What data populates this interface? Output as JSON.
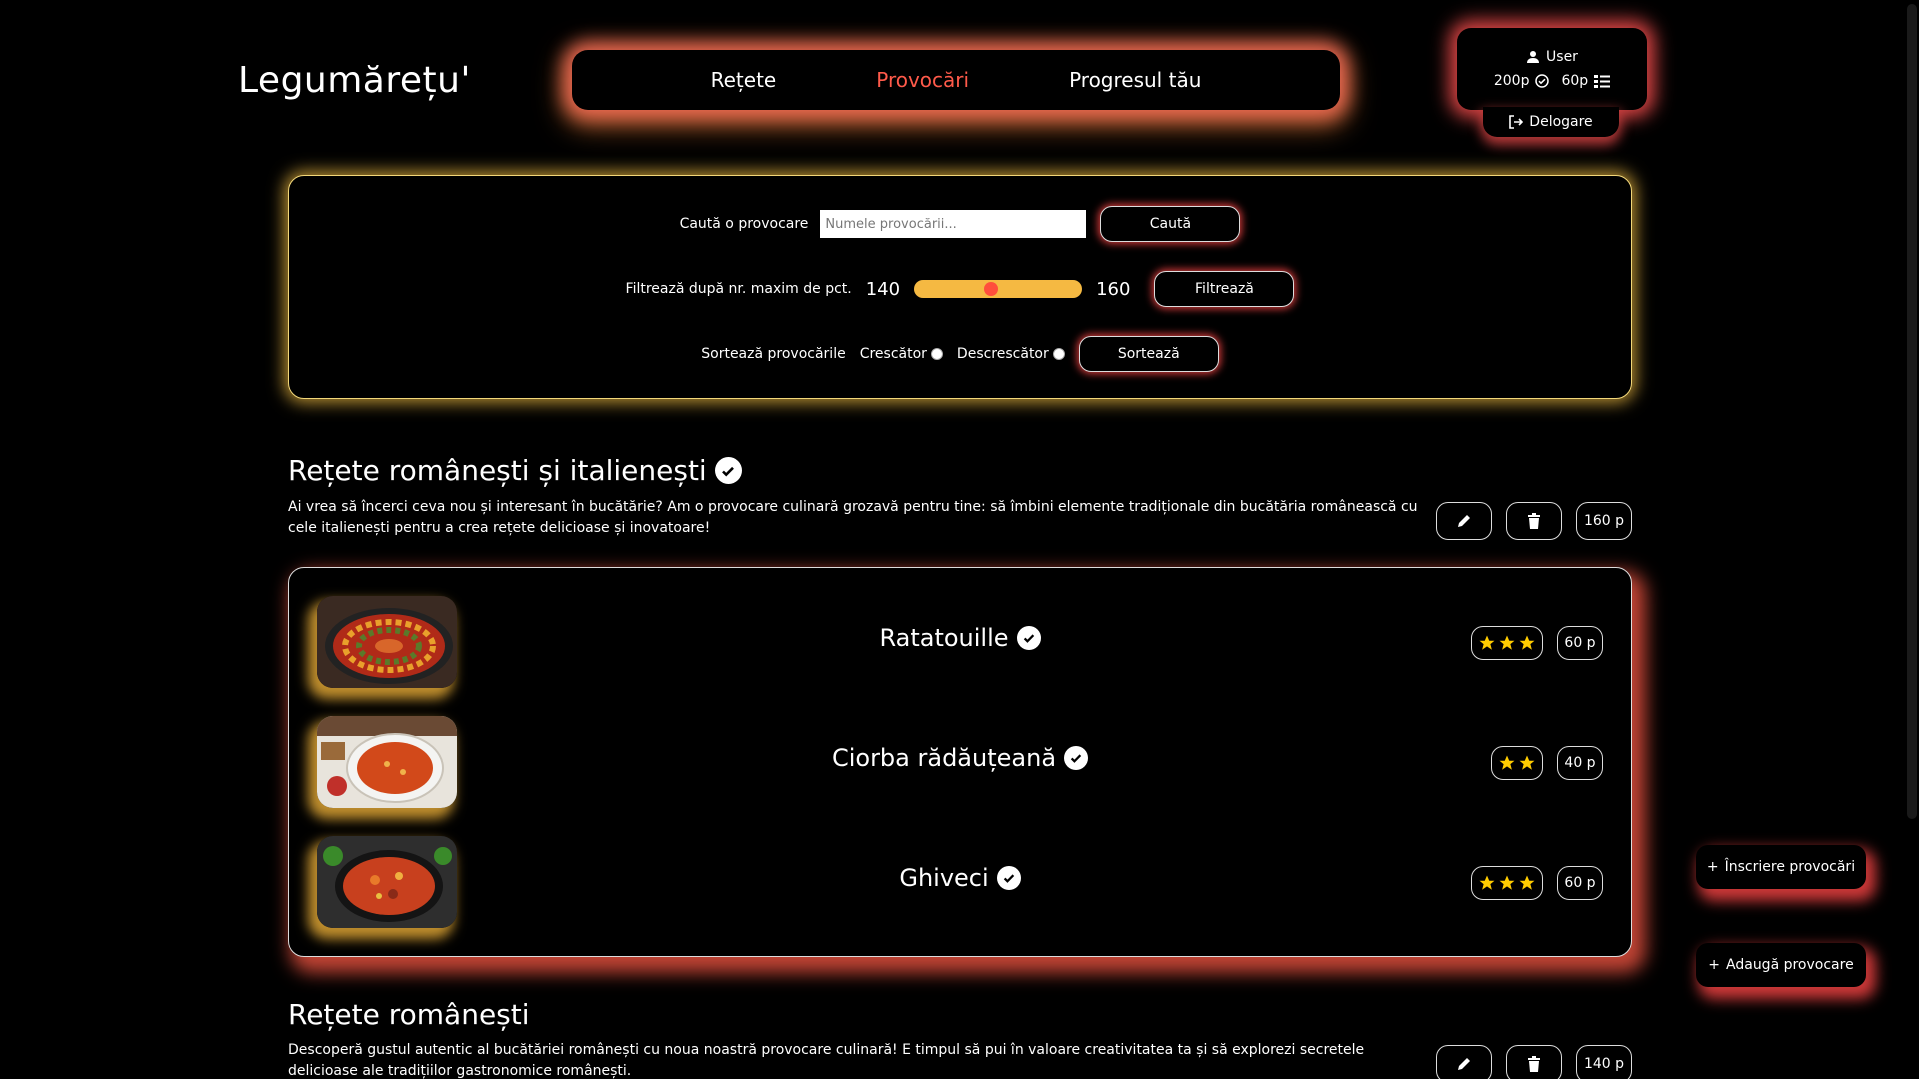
{
  "header": {
    "logo": "Legumărețu'",
    "nav": [
      {
        "label": "Rețete",
        "active": false
      },
      {
        "label": "Provocări",
        "active": true
      },
      {
        "label": "Progresul tău",
        "active": false
      }
    ],
    "user": {
      "name": "User",
      "points_done": "200p",
      "points_pending": "60p"
    },
    "logout_label": "Delogare"
  },
  "filters": {
    "search_label": "Caută o provocare",
    "search_placeholder": "Numele provocării...",
    "search_button": "Caută",
    "filter_label": "Filtrează după nr. maxim de pct.",
    "range_min": "140",
    "range_max": "160",
    "slider_value_fraction": 0.45,
    "filter_button": "Filtrează",
    "sort_label": "Sortează provocările",
    "sort_asc": "Crescător",
    "sort_desc": "Descrescător",
    "sort_button": "Sortează"
  },
  "challenges": [
    {
      "title": "Rețete românești și italienești",
      "description": "Ai vrea să încerci ceva nou și interesant în bucătărie? Am o provocare culinară grozavă pentru tine: să îmbini elemente tradiționale din bucătăria românească cu cele italienești pentru a crea rețete delicioase și inovatoare!",
      "points": "160 p",
      "recipes": [
        {
          "title": "Ratatouille",
          "stars": 3,
          "points": "60 p"
        },
        {
          "title": "Ciorba rădăuțeană",
          "stars": 2,
          "points": "40 p"
        },
        {
          "title": "Ghiveci",
          "stars": 3,
          "points": "60 p"
        }
      ]
    },
    {
      "title": "Rețete românești",
      "description": "Descoperă gustul autentic al bucătăriei românești cu noua noastră provocare culinară! E timpul să pui în valoare creativitatea ta și să explorezi secretele delicioase ale tradițiilor gastronomice românești.",
      "points": "140 p"
    }
  ],
  "side_actions": {
    "enroll": "Înscriere provocări",
    "add": "Adaugă provocare"
  },
  "colors": {
    "accent": "#ff5a4a",
    "glow_warm": "#f5b942",
    "star": "#ffcc00"
  }
}
